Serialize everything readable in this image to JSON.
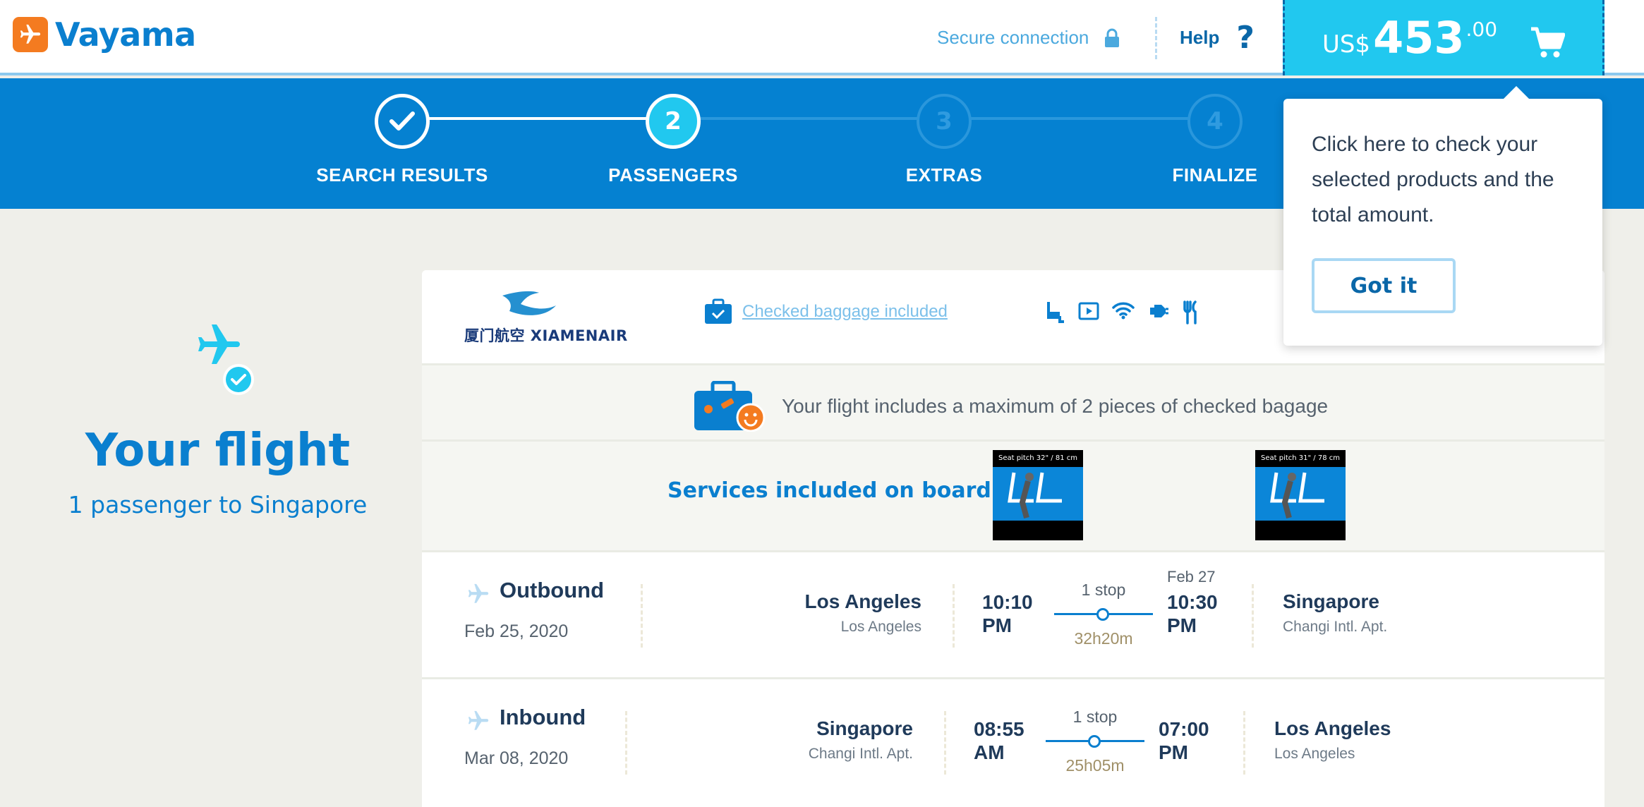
{
  "header": {
    "logo_text": "Vayama",
    "secure_label": "Secure connection",
    "help_label": "Help",
    "help_icon": "?",
    "cart": {
      "currency": "US$",
      "amount": "453",
      "decimals": ".00"
    }
  },
  "stepper": {
    "steps": [
      {
        "number": "",
        "label": "SEARCH RESULTS",
        "state": "done"
      },
      {
        "number": "2",
        "label": "PASSENGERS",
        "state": "active"
      },
      {
        "number": "3",
        "label": "EXTRAS",
        "state": "todo"
      },
      {
        "number": "4",
        "label": "FINALIZE",
        "state": "todo"
      }
    ]
  },
  "tooltip": {
    "text": "Click here to check your selected products and the total amount.",
    "button": "Got it"
  },
  "summary": {
    "title": "Your flight",
    "subtitle": "1 passenger to Singapore"
  },
  "flight": {
    "airline": "厦门航空 XIAMENAIR",
    "baggage_link": "Checked baggage included",
    "amenities": [
      "seat-icon",
      "entertainment-icon",
      "wifi-icon",
      "power-icon",
      "meal-icon"
    ],
    "baggage_info": "Your flight includes a maximum of 2 pieces of checked bagage",
    "services_label": "Services included on board:",
    "seats": [
      {
        "caption": "Seat pitch 32\" / 81 cm"
      },
      {
        "caption": "Seat pitch 31\" / 78 cm"
      }
    ],
    "legs": [
      {
        "title": "Outbound",
        "date": "Feb 25, 2020",
        "from_city": "Los Angeles",
        "from_sub": "Los Angeles",
        "dep_time": "10:10",
        "dep_ampm": "PM",
        "stops": "1 stop",
        "duration": "32h20m",
        "arr_date": "Feb 27",
        "arr_time": "10:30",
        "arr_ampm": "PM",
        "to_city": "Singapore",
        "to_sub": "Changi Intl. Apt."
      },
      {
        "title": "Inbound",
        "date": "Mar 08, 2020",
        "from_city": "Singapore",
        "from_sub": "Changi Intl. Apt.",
        "dep_time": "08:55",
        "dep_ampm": "AM",
        "stops": "1 stop",
        "duration": "25h05m",
        "arr_time": "07:00",
        "arr_ampm": "PM",
        "to_city": "Los Angeles",
        "to_sub": "Los Angeles"
      }
    ]
  },
  "colors": {
    "brand_blue": "#0581d1",
    "cart_cyan": "#21c8ef",
    "logo_orange": "#f47b20"
  }
}
